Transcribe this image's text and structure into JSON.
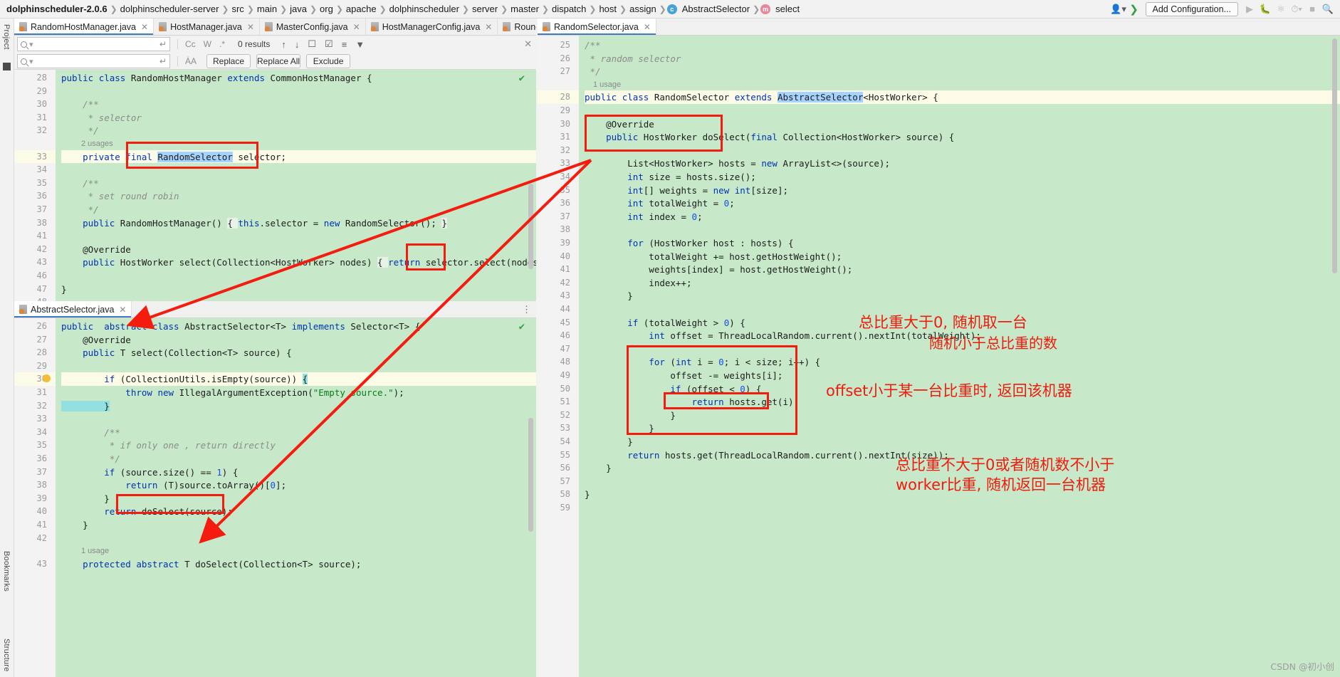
{
  "window": {
    "breadcrumb": [
      "dolphinscheduler-2.0.6",
      "dolphinscheduler-server",
      "src",
      "main",
      "java",
      "org",
      "apache",
      "dolphinscheduler",
      "server",
      "master",
      "dispatch",
      "host",
      "assign",
      "AbstractSelector",
      "select"
    ],
    "class_badge": "c",
    "method_badge": "m",
    "run_config": "Add Configuration...",
    "icons": {
      "profile": "profile-dropdown-icon",
      "branch": "vcs-branch-icon",
      "run": "run-icon",
      "debug": "debug-icon",
      "coverage": "coverage-icon",
      "profiler": "profiler-icon",
      "stop": "stop-icon",
      "search_everywhere": "search-everywhere-icon"
    }
  },
  "left_rail": {
    "project": "Project",
    "bookmarks": "Bookmarks",
    "structure": "Structure"
  },
  "tabs_left": [
    {
      "label": "RandomHostManager.java",
      "active": true
    },
    {
      "label": "HostManager.java",
      "active": false
    },
    {
      "label": "MasterConfig.java",
      "active": false
    },
    {
      "label": "HostManagerConfig.java",
      "active": false
    },
    {
      "label": "RoundRobinHos",
      "active": false,
      "truncated": true
    }
  ],
  "tabs_right": [
    {
      "label": "RandomSelector.java",
      "active": true
    }
  ],
  "tab_bottom_left": {
    "label": "AbstractSelector.java",
    "active": true
  },
  "find_panel": {
    "search_value": "",
    "replace_value": "",
    "results_text": "0 results",
    "options": [
      "Cc",
      "W",
      ".*"
    ],
    "match_case_toggle": "Cc",
    "words_toggle": "W",
    "regex_toggle": ".*",
    "buttons": [
      "Replace",
      "Replace All",
      "Exclude"
    ],
    "icons": [
      "prev-occurrence-icon",
      "next-occurrence-icon",
      "select-all-icon",
      "preserve-case-icon",
      "in-comments-icon",
      "filter-icon",
      "new-line-icon",
      "case-icon",
      "close-icon"
    ]
  },
  "editor_top_left": {
    "file": "RandomHostManager.java",
    "usage_hint": "2 usages",
    "lines": [
      {
        "n": "28",
        "tokens": [
          [
            "k",
            "public "
          ],
          [
            "k",
            "class "
          ],
          [
            "pl",
            "RandomHostManager "
          ],
          [
            "k",
            "extends "
          ],
          [
            "pl",
            "CommonHostManager {"
          ]
        ]
      },
      {
        "n": "29",
        "tokens": []
      },
      {
        "n": "30",
        "tokens": [
          [
            "cm",
            "    /**"
          ]
        ]
      },
      {
        "n": "31",
        "tokens": [
          [
            "cm",
            "     * selector"
          ]
        ]
      },
      {
        "n": "32",
        "tokens": [
          [
            "cm",
            "     */"
          ]
        ]
      },
      {
        "n": "33",
        "tokens": [
          [
            "k",
            "    private final "
          ],
          [
            "sel",
            "RandomSelector"
          ],
          [
            "pl",
            " selector;"
          ]
        ],
        "highlight": true
      },
      {
        "n": "34",
        "tokens": []
      },
      {
        "n": "35",
        "tokens": [
          [
            "cm",
            "    /**"
          ]
        ]
      },
      {
        "n": "36",
        "tokens": [
          [
            "cm",
            "     * set round robin"
          ]
        ]
      },
      {
        "n": "37",
        "tokens": [
          [
            "cm",
            "     */"
          ]
        ]
      },
      {
        "n": "38",
        "tokens": [
          [
            "k",
            "    public "
          ],
          [
            "pl",
            "RandomHostManager() "
          ],
          [
            "brc",
            "{ "
          ],
          [
            "k",
            "this"
          ],
          [
            "pl",
            ".selector = "
          ],
          [
            "k",
            "new "
          ],
          [
            "pl",
            "RandomSelector(); "
          ],
          [
            "brc",
            "}"
          ]
        ]
      },
      {
        "n": "41",
        "tokens": []
      },
      {
        "n": "42",
        "tokens": [
          [
            "pl",
            "    @Override"
          ]
        ]
      },
      {
        "n": "43",
        "tokens": [
          [
            "k",
            "    public "
          ],
          [
            "pl",
            "HostWorker select(Collection<HostWorker> nodes) "
          ],
          [
            "brc",
            "{ "
          ],
          [
            "k",
            "return "
          ],
          [
            "pl",
            "selector.select(nodes); "
          ],
          [
            "brc",
            "}"
          ]
        ]
      },
      {
        "n": "46",
        "tokens": []
      },
      {
        "n": "47",
        "tokens": [
          [
            "pl",
            "}"
          ]
        ]
      },
      {
        "n": "48",
        "tokens": []
      }
    ]
  },
  "editor_bottom_left": {
    "file": "AbstractSelector.java",
    "usage_hint": "1 usage",
    "lines": [
      {
        "n": "26",
        "tokens": [
          [
            "k",
            "public  abstract class "
          ],
          [
            "pl",
            "AbstractSelector<T> "
          ],
          [
            "k",
            "implements "
          ],
          [
            "pl",
            "Selector<T> {"
          ]
        ]
      },
      {
        "n": "27",
        "tokens": [
          [
            "pl",
            "    @Override"
          ]
        ]
      },
      {
        "n": "28",
        "tokens": [
          [
            "k",
            "    public "
          ],
          [
            "pl",
            "T select(Collection<T> source) {"
          ]
        ]
      },
      {
        "n": "29",
        "tokens": []
      },
      {
        "n": "30",
        "tokens": [
          [
            "k",
            "        if "
          ],
          [
            "pl",
            "(CollectionUtils.isEmpty(source)) "
          ],
          [
            "cyan",
            "{"
          ]
        ],
        "highlight": true,
        "bulb": true
      },
      {
        "n": "31",
        "tokens": [
          [
            "k",
            "            throw new "
          ],
          [
            "pl",
            "IllegalArgumentException("
          ],
          [
            "st",
            "\"Empty source.\""
          ],
          [
            "pl",
            ");"
          ]
        ]
      },
      {
        "n": "32",
        "tokens": [
          [
            "cyan",
            "        }"
          ]
        ]
      },
      {
        "n": "33",
        "tokens": []
      },
      {
        "n": "34",
        "tokens": [
          [
            "cm",
            "        /**"
          ]
        ]
      },
      {
        "n": "35",
        "tokens": [
          [
            "cm",
            "         * if only one , return directly"
          ]
        ]
      },
      {
        "n": "36",
        "tokens": [
          [
            "cm",
            "         */"
          ]
        ]
      },
      {
        "n": "37",
        "tokens": [
          [
            "k",
            "        if "
          ],
          [
            "pl",
            "(source.size() == "
          ],
          [
            "nm",
            "1"
          ],
          [
            "pl",
            ") {"
          ]
        ]
      },
      {
        "n": "38",
        "tokens": [
          [
            "k",
            "            return "
          ],
          [
            "pl",
            "(T)source.toArray()["
          ],
          [
            "nm",
            "0"
          ],
          [
            "pl",
            "];"
          ]
        ]
      },
      {
        "n": "39",
        "tokens": [
          [
            "pl",
            "        }"
          ]
        ]
      },
      {
        "n": "40",
        "tokens": [
          [
            "k",
            "        return "
          ],
          [
            "pl",
            "doSelect(source);"
          ]
        ]
      },
      {
        "n": "41",
        "tokens": [
          [
            "pl",
            "    }"
          ]
        ]
      },
      {
        "n": "42",
        "tokens": []
      },
      {
        "n": "43",
        "tokens": [
          [
            "k",
            "    protected abstract "
          ],
          [
            "pl",
            "T doSelect(Collection<T> source);"
          ]
        ]
      }
    ]
  },
  "editor_right": {
    "file": "RandomSelector.java",
    "usage_hint": "1 usage",
    "lines": [
      {
        "n": "25",
        "tokens": [
          [
            "cm",
            "/**"
          ]
        ]
      },
      {
        "n": "26",
        "tokens": [
          [
            "cm",
            " * random selector"
          ]
        ]
      },
      {
        "n": "27",
        "tokens": [
          [
            "cm",
            " */"
          ]
        ]
      },
      {
        "n": "28",
        "tokens": [
          [
            "k",
            "public "
          ],
          [
            "k",
            "class "
          ],
          [
            "pl",
            "RandomSelector "
          ],
          [
            "k",
            "extends "
          ],
          [
            "sel",
            "AbstractSelector"
          ],
          [
            "pl",
            "<HostWorker> {"
          ]
        ],
        "highlight": true
      },
      {
        "n": "29",
        "tokens": []
      },
      {
        "n": "30",
        "tokens": [
          [
            "pl",
            "    @Override"
          ]
        ]
      },
      {
        "n": "31",
        "tokens": [
          [
            "k",
            "    public "
          ],
          [
            "pl",
            "HostWorker doSelect("
          ],
          [
            "k",
            "final "
          ],
          [
            "pl",
            "Collection<HostWorker> source) {"
          ]
        ]
      },
      {
        "n": "32",
        "tokens": []
      },
      {
        "n": "33",
        "tokens": [
          [
            "pl",
            "        List<HostWorker> hosts = "
          ],
          [
            "k",
            "new "
          ],
          [
            "pl",
            "ArrayList<>(source);"
          ]
        ]
      },
      {
        "n": "34",
        "tokens": [
          [
            "k",
            "        int "
          ],
          [
            "pl",
            "size = hosts.size();"
          ]
        ]
      },
      {
        "n": "35",
        "tokens": [
          [
            "k",
            "        int"
          ],
          [
            "pl",
            "[] weights = "
          ],
          [
            "k",
            "new int"
          ],
          [
            "pl",
            "[size];"
          ]
        ]
      },
      {
        "n": "36",
        "tokens": [
          [
            "k",
            "        int "
          ],
          [
            "pl",
            "totalWeight = "
          ],
          [
            "nm",
            "0"
          ],
          [
            "pl",
            ";"
          ]
        ]
      },
      {
        "n": "37",
        "tokens": [
          [
            "k",
            "        int "
          ],
          [
            "pl",
            "index = "
          ],
          [
            "nm",
            "0"
          ],
          [
            "pl",
            ";"
          ]
        ]
      },
      {
        "n": "38",
        "tokens": []
      },
      {
        "n": "39",
        "tokens": [
          [
            "k",
            "        for "
          ],
          [
            "pl",
            "(HostWorker host : hosts) {"
          ]
        ]
      },
      {
        "n": "40",
        "tokens": [
          [
            "pl",
            "            totalWeight += host.getHostWeight();"
          ]
        ]
      },
      {
        "n": "41",
        "tokens": [
          [
            "pl",
            "            weights[index] = host.getHostWeight();"
          ]
        ]
      },
      {
        "n": "42",
        "tokens": [
          [
            "pl",
            "            index++;"
          ]
        ]
      },
      {
        "n": "43",
        "tokens": [
          [
            "pl",
            "        }"
          ]
        ]
      },
      {
        "n": "44",
        "tokens": []
      },
      {
        "n": "45",
        "tokens": [
          [
            "k",
            "        if "
          ],
          [
            "pl",
            "(totalWeight > "
          ],
          [
            "nm",
            "0"
          ],
          [
            "pl",
            ") {"
          ]
        ]
      },
      {
        "n": "46",
        "tokens": [
          [
            "k",
            "            int "
          ],
          [
            "pl",
            "offset = ThreadLocalRandom.current().nextInt(totalWeight);"
          ]
        ]
      },
      {
        "n": "47",
        "tokens": []
      },
      {
        "n": "48",
        "tokens": [
          [
            "k",
            "            for "
          ],
          [
            "pl",
            "("
          ],
          [
            "k",
            "int "
          ],
          [
            "pl",
            "i = "
          ],
          [
            "nm",
            "0"
          ],
          [
            "pl",
            "; i < size; i++) {"
          ]
        ]
      },
      {
        "n": "49",
        "tokens": [
          [
            "pl",
            "                offset -= weights[i];"
          ]
        ]
      },
      {
        "n": "50",
        "tokens": [
          [
            "k",
            "                if "
          ],
          [
            "pl",
            "(offset < "
          ],
          [
            "nm",
            "0"
          ],
          [
            "pl",
            ") {"
          ]
        ]
      },
      {
        "n": "51",
        "tokens": [
          [
            "k",
            "                    return "
          ],
          [
            "pl",
            "hosts.get(i);"
          ]
        ]
      },
      {
        "n": "52",
        "tokens": [
          [
            "pl",
            "                }"
          ]
        ]
      },
      {
        "n": "53",
        "tokens": [
          [
            "pl",
            "            }"
          ]
        ]
      },
      {
        "n": "54",
        "tokens": [
          [
            "pl",
            "        }"
          ]
        ]
      },
      {
        "n": "55",
        "tokens": [
          [
            "k",
            "        return "
          ],
          [
            "pl",
            "hosts.get(ThreadLocalRandom.current().nextInt(size));"
          ]
        ]
      },
      {
        "n": "56",
        "tokens": [
          [
            "pl",
            "    }"
          ]
        ]
      },
      {
        "n": "57",
        "tokens": []
      },
      {
        "n": "58",
        "tokens": [
          [
            "pl",
            "}"
          ]
        ]
      },
      {
        "n": "59",
        "tokens": []
      }
    ]
  },
  "annotations": {
    "note_1": "总比重大于0, 随机取一台",
    "note_2": "随机小于总比重的数",
    "note_3": "offset小于某一台比重时, 返回该机器",
    "note_4a": "总比重不大于0或者随机数不小于",
    "note_4b": "worker比重, 随机返回一台机器",
    "color": "#ef1b0d"
  },
  "watermark": "CSDN @初小创"
}
